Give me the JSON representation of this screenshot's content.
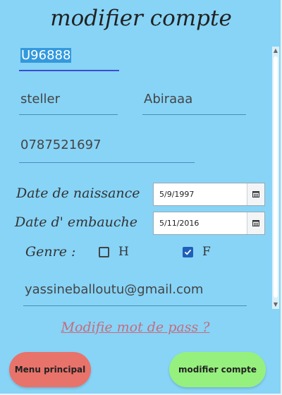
{
  "title": "modifier compte",
  "username": "U96888",
  "last_name": "steller",
  "first_name": "Abiraaa",
  "phone": "0787521697",
  "birth": {
    "label": "Date de naissance",
    "value": "5/9/1997"
  },
  "hire": {
    "label": "Date d' embauche",
    "value": "5/11/2016"
  },
  "genre": {
    "label": "Genre :",
    "h_label": "H",
    "f_label": "F",
    "h_checked": false,
    "f_checked": true
  },
  "email": "yassineballoutu@gmail.com",
  "change_password_link": "Modifie mot de pass ?",
  "buttons": {
    "menu": "Menu principal",
    "modify": "modifier compte"
  },
  "colors": {
    "background": "#87d4f7",
    "menu_button": "#e8736b",
    "modify_button": "#96f07e",
    "link": "#c76b7c",
    "checkbox": "#1f5fb8"
  },
  "icons": {
    "date_picker": "calendar-icon",
    "checkmark": "check-icon"
  }
}
